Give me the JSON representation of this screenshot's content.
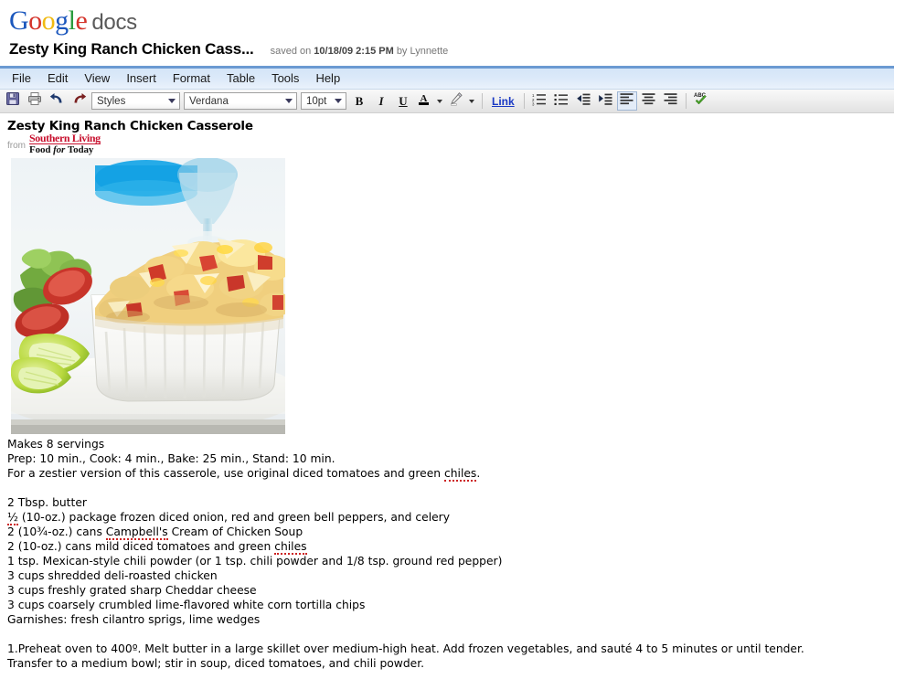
{
  "brand": {
    "google_letters": [
      "G",
      "o",
      "o",
      "g",
      "l",
      "e"
    ],
    "product": "docs"
  },
  "header": {
    "doc_title": "Zesty King Ranch Chicken Cass...",
    "saved_prefix": "saved on",
    "saved_date": "10/18/09 2:15 PM",
    "saved_suffix": "by Lynnette"
  },
  "menu": {
    "items": [
      {
        "label": "File"
      },
      {
        "label": "Edit"
      },
      {
        "label": "View"
      },
      {
        "label": "Insert"
      },
      {
        "label": "Format"
      },
      {
        "label": "Table"
      },
      {
        "label": "Tools"
      },
      {
        "label": "Help"
      }
    ]
  },
  "toolbar": {
    "save_icon": "floppy-disk-icon",
    "print_icon": "printer-icon",
    "undo_icon": "undo-arrow-icon",
    "redo_icon": "redo-arrow-icon",
    "styles_value": "Styles",
    "font_value": "Verdana",
    "size_value": "10pt",
    "bold_label": "B",
    "italic_label": "I",
    "underline_label": "U",
    "text_color_label": "A",
    "highlight_icon": "marker-pen-icon",
    "link_label": "Link",
    "numbered_list_icon": "numbered-list-icon",
    "bulleted_list_icon": "bulleted-list-icon",
    "outdent_icon": "outdent-icon",
    "indent_icon": "indent-icon",
    "align_left_icon": "align-left-icon",
    "align_center_icon": "align-center-icon",
    "align_right_icon": "align-right-icon",
    "spellcheck_icon": "spellcheck-abc-icon",
    "active_button": "align-left"
  },
  "document": {
    "recipe_title": "Zesty King Ranch Chicken Casserole",
    "attribution": {
      "from": "from",
      "brand": "Southern Living",
      "publication_plain": "Food ",
      "publication_italic": "for ",
      "publication_plain2": "Today"
    },
    "photo_alt": "chicken casserole in white baking dish with lime wedges and salad",
    "servings": "Makes 8 servings",
    "times": "Prep: 10 min., Cook: 4 min., Bake: 25 min., Stand: 10 min.",
    "note_part1": "For a zestier version of this casserole, use original diced tomatoes and green ",
    "note_misspelled": "chiles",
    "note_part2": ".",
    "ingredients": [
      {
        "text": "2 Tbsp. butter"
      },
      {
        "pre": "",
        "misspelled": "½",
        "post": " (10-oz.) package frozen diced onion, red and green bell peppers, and celery"
      },
      {
        "pre": "2 (10¾-oz.) cans ",
        "misspelled": "Campbell's",
        "post": " Cream of Chicken Soup"
      },
      {
        "pre": "2 (10-oz.) cans mild diced tomatoes and green ",
        "misspelled": "chiles",
        "post": ""
      },
      {
        "text": "1 tsp. Mexican-style chili powder (or 1 tsp. chili powder and 1/8 tsp. ground red pepper)"
      },
      {
        "text": "3 cups shredded deli-roasted chicken"
      },
      {
        "text": "3 cups freshly grated sharp Cheddar cheese"
      },
      {
        "text": "3 cups coarsely crumbled lime-flavored white corn tortilla chips"
      },
      {
        "text": "Garnishes: fresh cilantro sprigs, lime wedges"
      }
    ],
    "instructions": [
      "1.Preheat oven to 400º. Melt butter in a large skillet over medium-high heat. Add frozen vegetables, and sauté 4 to 5 minutes or until tender.",
      "Transfer to a medium bowl; stir in soup, diced tomatoes, and chili powder."
    ]
  },
  "colors": {
    "menu_bar": "#d9e8f8",
    "title_divider": "#6b9ad2",
    "link_blue": "#1a39c4",
    "brand_red": "#c8102e",
    "spellcheck_underline": "#cc2222"
  }
}
